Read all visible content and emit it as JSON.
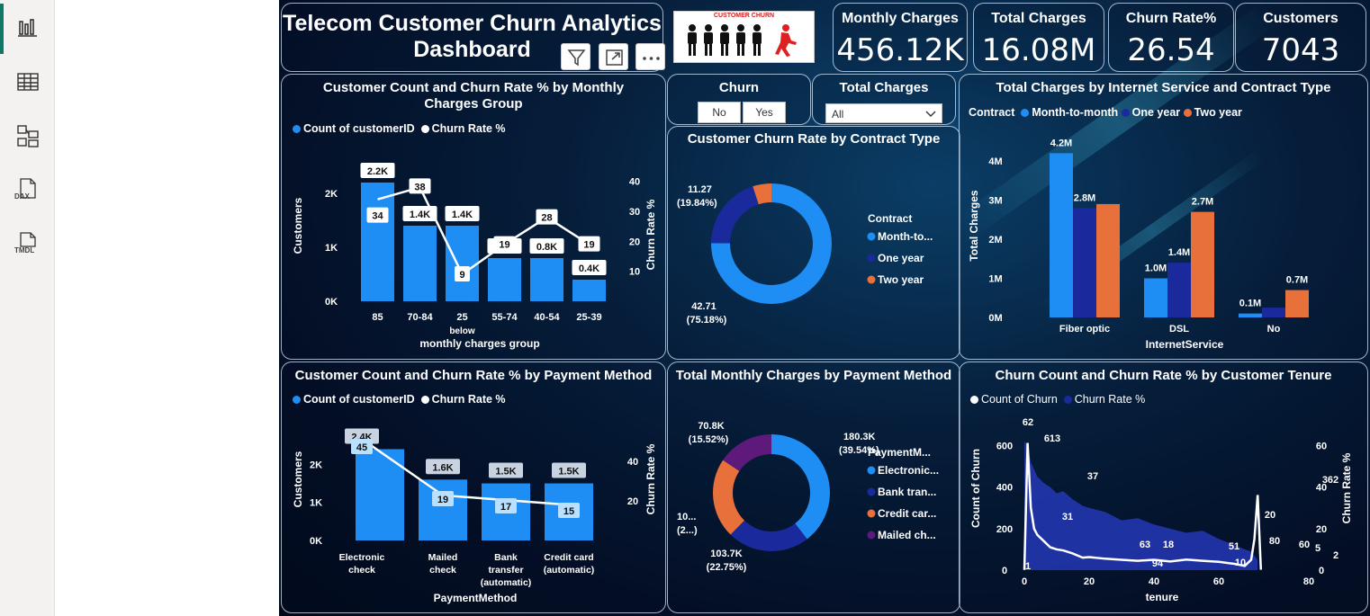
{
  "rail": {
    "dax": "DAX",
    "tmdl": "TMDL"
  },
  "header": {
    "title_line1": "Telecom Customer Churn Analytics",
    "title_line2": "Dashboard",
    "logo_text": "CUSTOMER CHURN"
  },
  "kpis": [
    {
      "title": "Monthly Charges",
      "value": "456.12K"
    },
    {
      "title": "Total Charges",
      "value": "16.08M"
    },
    {
      "title": "Churn Rate%",
      "value": "26.54"
    },
    {
      "title": "Customers",
      "value": "7043"
    }
  ],
  "filters": {
    "churn_title": "Churn",
    "churn_options": [
      "No",
      "Yes"
    ],
    "total_charges_title": "Total Charges",
    "total_charges_value": "All"
  },
  "colors": {
    "blue": "#1e8ef5",
    "navy": "#1a2a9c",
    "orange": "#e8703a",
    "purple": "#5d1a7a",
    "white": "#ffffff"
  },
  "chart_data": [
    {
      "id": "monthly_group",
      "type": "bar",
      "title": "Customer Count and Churn Rate % by Monthly Charges Group",
      "legend": [
        "Count of customerID",
        "Churn Rate %"
      ],
      "xlabel": "monthly charges group",
      "ylabel": "Customers",
      "y2label": "Churn Rate %",
      "categories": [
        "85",
        "70-84",
        "25 below",
        "55-74",
        "40-54",
        "25-39"
      ],
      "bar_labels": [
        "2.2K",
        "1.4K",
        "1.4K",
        "0.8K",
        "0.8K",
        "0.4K"
      ],
      "values": [
        2200,
        1400,
        1400,
        800,
        800,
        400
      ],
      "line_values": [
        34,
        38,
        9,
        19,
        28,
        19
      ],
      "yticks": [
        "0K",
        "1K",
        "2K"
      ],
      "ylim": [
        0,
        2500
      ],
      "y2ticks": [
        "10",
        "20",
        "30",
        "40"
      ],
      "y2lim": [
        0,
        45
      ]
    },
    {
      "id": "contract_donut",
      "type": "pie",
      "title": "Customer Churn Rate by Contract Type",
      "legend_title": "Contract",
      "legend": [
        "Month-to...",
        "One year",
        "Two year"
      ],
      "values": [
        42.71,
        11.27,
        2.84
      ],
      "slice_labels": [
        {
          "value": "42.71",
          "pct": "(75.18%)"
        },
        {
          "value": "11.27",
          "pct": "(19.84%)"
        }
      ]
    },
    {
      "id": "internet_contract",
      "type": "bar",
      "title": "Total Charges by Internet Service and Contract Type",
      "legend_title": "Contract",
      "legend": [
        "Month-to-month",
        "One year",
        "Two year"
      ],
      "xlabel": "InternetService",
      "ylabel": "Total Charges",
      "categories": [
        "Fiber optic",
        "DSL",
        "No"
      ],
      "series": [
        {
          "name": "Month-to-month",
          "values": [
            4.2,
            1.0,
            0.1
          ],
          "labels": [
            "4.2M",
            "1.0M",
            "0.1M"
          ]
        },
        {
          "name": "One year",
          "values": [
            2.8,
            1.4,
            0.25
          ],
          "labels": [
            "2.8M",
            "1.4M",
            ""
          ]
        },
        {
          "name": "Two year",
          "values": [
            2.9,
            2.7,
            0.7
          ],
          "labels": [
            "",
            "2.7M",
            "0.7M"
          ]
        }
      ],
      "yticks": [
        "0M",
        "1M",
        "2M",
        "3M",
        "4M"
      ],
      "ylim": [
        0,
        4.6
      ]
    },
    {
      "id": "payment_method",
      "type": "bar",
      "title": "Customer Count and Churn Rate % by Payment Method",
      "legend": [
        "Count of customerID",
        "Churn Rate %"
      ],
      "xlabel": "PaymentMethod",
      "ylabel": "Customers",
      "y2label": "Churn Rate %",
      "categories": [
        "Electronic check",
        "Mailed check",
        "Bank transfer (automatic)",
        "Credit card (automatic)"
      ],
      "bar_labels": [
        "2.4K",
        "1.6K",
        "1.5K",
        "1.5K"
      ],
      "values": [
        2400,
        1600,
        1500,
        1500
      ],
      "line_values": [
        45,
        19,
        17,
        15
      ],
      "yticks": [
        "0K",
        "1K",
        "2K"
      ],
      "ylim": [
        0,
        2600
      ],
      "y2ticks": [
        "20",
        "40"
      ],
      "y2lim": [
        0,
        50
      ]
    },
    {
      "id": "payment_donut",
      "type": "pie",
      "title": "Total Monthly Charges by Payment Method",
      "legend_title": "PaymentM...",
      "legend": [
        "Electronic...",
        "Bank tran...",
        "Credit car...",
        "Mailed ch..."
      ],
      "values": [
        180.3,
        103.7,
        101.0,
        70.8
      ],
      "slice_labels": [
        {
          "value": "180.3K",
          "pct": "(39.54%)"
        },
        {
          "value": "103.7K",
          "pct": "(22.75%)"
        },
        {
          "value": "10...",
          "pct": "(2...)"
        },
        {
          "value": "70.8K",
          "pct": "(15.52%)"
        }
      ]
    },
    {
      "id": "tenure",
      "type": "area",
      "title": "Churn Count and Churn Rate % by Customer Tenure",
      "legend": [
        "Count of Churn",
        "Churn Rate %"
      ],
      "xlabel": "tenure",
      "ylabel": "Count of Churn",
      "y2label": "Churn Rate %",
      "xticks": [
        "0",
        "20",
        "40",
        "60",
        "80"
      ],
      "xlim": [
        0,
        80
      ],
      "yticks": [
        "0",
        "200",
        "400",
        "600"
      ],
      "ylim": [
        0,
        650
      ],
      "y2ticks": [
        "0",
        "20",
        "40",
        "60"
      ],
      "y2lim": [
        0,
        65
      ],
      "annotations": [
        "62",
        "613",
        "37",
        "31",
        "63",
        "18",
        "94",
        "51",
        "10",
        "20",
        "80",
        "60",
        "5",
        "362",
        "2",
        "1"
      ],
      "churn_count": [
        [
          0,
          1
        ],
        [
          1,
          613
        ],
        [
          2,
          300
        ],
        [
          3,
          200
        ],
        [
          4,
          170
        ],
        [
          6,
          140
        ],
        [
          8,
          110
        ],
        [
          10,
          100
        ],
        [
          12,
          95
        ],
        [
          15,
          80
        ],
        [
          18,
          60
        ],
        [
          20,
          63
        ],
        [
          25,
          55
        ],
        [
          30,
          50
        ],
        [
          35,
          45
        ],
        [
          40,
          50
        ],
        [
          45,
          42
        ],
        [
          50,
          51
        ],
        [
          55,
          45
        ],
        [
          60,
          40
        ],
        [
          65,
          30
        ],
        [
          68,
          20
        ],
        [
          70,
          50
        ],
        [
          71,
          150
        ],
        [
          72,
          362
        ],
        [
          73,
          2
        ]
      ],
      "churn_rate": [
        [
          0,
          62
        ],
        [
          1,
          60
        ],
        [
          2,
          52
        ],
        [
          4,
          45
        ],
        [
          6,
          42
        ],
        [
          8,
          40
        ],
        [
          10,
          37
        ],
        [
          12,
          38
        ],
        [
          15,
          34
        ],
        [
          18,
          31
        ],
        [
          20,
          30
        ],
        [
          25,
          28
        ],
        [
          30,
          24
        ],
        [
          35,
          25
        ],
        [
          40,
          22
        ],
        [
          45,
          20
        ],
        [
          50,
          18
        ],
        [
          55,
          19
        ],
        [
          60,
          15
        ],
        [
          65,
          12
        ],
        [
          68,
          10
        ],
        [
          70,
          9
        ],
        [
          72,
          5
        ]
      ]
    }
  ]
}
